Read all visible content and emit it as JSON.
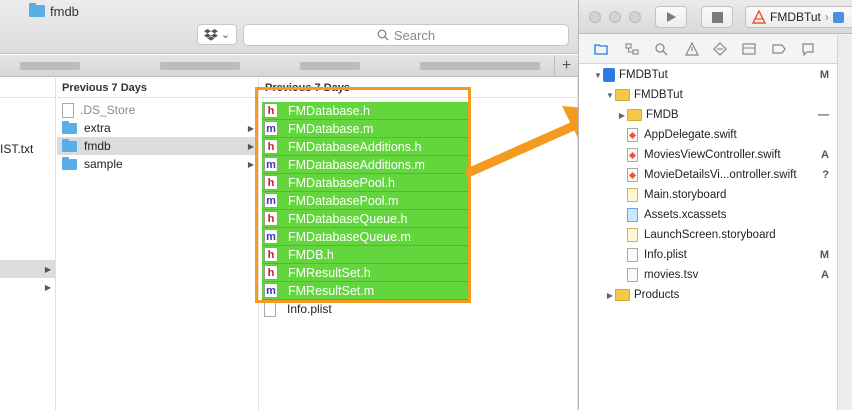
{
  "finder": {
    "title": "fmdb",
    "search_placeholder": "Search",
    "add_tab": "+",
    "col1_items": [
      "IST.txt"
    ],
    "col2": {
      "header": "Previous 7 Days",
      "items": [
        {
          "name": ".DS_Store",
          "kind": "file",
          "dim": true,
          "folder": false
        },
        {
          "name": "extra",
          "kind": "folder",
          "dim": false,
          "folder": true
        },
        {
          "name": "fmdb",
          "kind": "folder",
          "dim": false,
          "folder": true,
          "selected": true
        },
        {
          "name": "sample",
          "kind": "folder",
          "dim": false,
          "folder": true
        }
      ]
    },
    "col3": {
      "header": "Previous 7 Days",
      "selected_items": [
        {
          "name": "FMDatabase.h",
          "ext": "h"
        },
        {
          "name": "FMDatabase.m",
          "ext": "m"
        },
        {
          "name": "FMDatabaseAdditions.h",
          "ext": "h"
        },
        {
          "name": "FMDatabaseAdditions.m",
          "ext": "m"
        },
        {
          "name": "FMDatabasePool.h",
          "ext": "h"
        },
        {
          "name": "FMDatabasePool.m",
          "ext": "m"
        },
        {
          "name": "FMDatabaseQueue.h",
          "ext": "h"
        },
        {
          "name": "FMDatabaseQueue.m",
          "ext": "m"
        },
        {
          "name": "FMDB.h",
          "ext": "h"
        },
        {
          "name": "FMResultSet.h",
          "ext": "h"
        },
        {
          "name": "FMResultSet.m",
          "ext": "m"
        }
      ],
      "other_items": [
        "Info.plist"
      ]
    },
    "colors": {
      "selection_green": "#62d63c",
      "highlight_orange": "#f49a1f"
    }
  },
  "xcode": {
    "scheme": "FMDBTut",
    "tree": [
      {
        "label": "FMDBTut",
        "type": "project",
        "indent": 0,
        "disclosure": "open",
        "status": "M"
      },
      {
        "label": "FMDBTut",
        "type": "folder",
        "indent": 1,
        "disclosure": "open",
        "status": ""
      },
      {
        "label": "FMDB",
        "type": "folder",
        "indent": 2,
        "disclosure": "closed",
        "status": "—"
      },
      {
        "label": "AppDelegate.swift",
        "type": "swift",
        "indent": 2,
        "disclosure": "",
        "status": ""
      },
      {
        "label": "MoviesViewController.swift",
        "type": "swift",
        "indent": 2,
        "disclosure": "",
        "status": "A"
      },
      {
        "label": "MovieDetailsVi...ontroller.swift",
        "type": "swift",
        "indent": 2,
        "disclosure": "",
        "status": "?"
      },
      {
        "label": "Main.storyboard",
        "type": "sb",
        "indent": 2,
        "disclosure": "",
        "status": ""
      },
      {
        "label": "Assets.xcassets",
        "type": "asset",
        "indent": 2,
        "disclosure": "",
        "status": ""
      },
      {
        "label": "LaunchScreen.storyboard",
        "type": "sb",
        "indent": 2,
        "disclosure": "",
        "status": ""
      },
      {
        "label": "Info.plist",
        "type": "plain",
        "indent": 2,
        "disclosure": "",
        "status": "M"
      },
      {
        "label": "movies.tsv",
        "type": "plain",
        "indent": 2,
        "disclosure": "",
        "status": "A"
      },
      {
        "label": "Products",
        "type": "folder",
        "indent": 1,
        "disclosure": "closed",
        "status": ""
      }
    ]
  }
}
